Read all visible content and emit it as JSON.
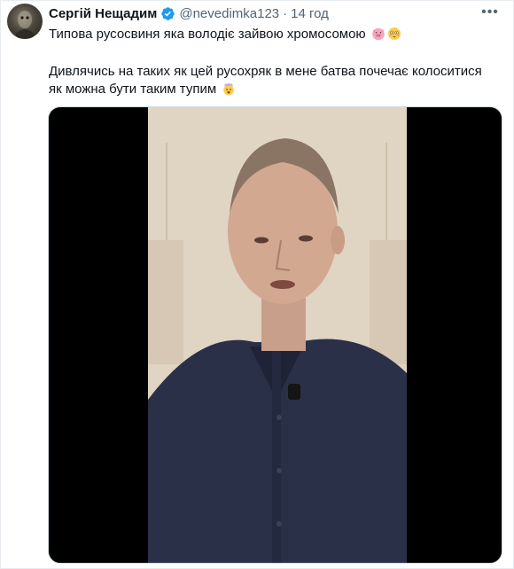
{
  "tweet": {
    "author_name": "Сергій Нещадим",
    "handle": "@nevedimka123",
    "separator": "·",
    "timestamp": "14 год",
    "line1": "Типова русосвиня яка володіє зайвою хромосомою",
    "line2": "Дивлячись на таких як цей русохряк в мене батва почечає колоситися як можна бути таким тупим",
    "line1_emojis": [
      "pig-face-emoji",
      "flushed-face-emoji"
    ],
    "line2_emojis": [
      "exploding-head-emoji"
    ]
  },
  "icons": {
    "verified": "verified-badge-icon",
    "more": "more-options-icon"
  },
  "colors": {
    "text": "#0f1419",
    "secondary": "#536471",
    "verified": "#1d9bf0",
    "media_bg": "#000000"
  }
}
